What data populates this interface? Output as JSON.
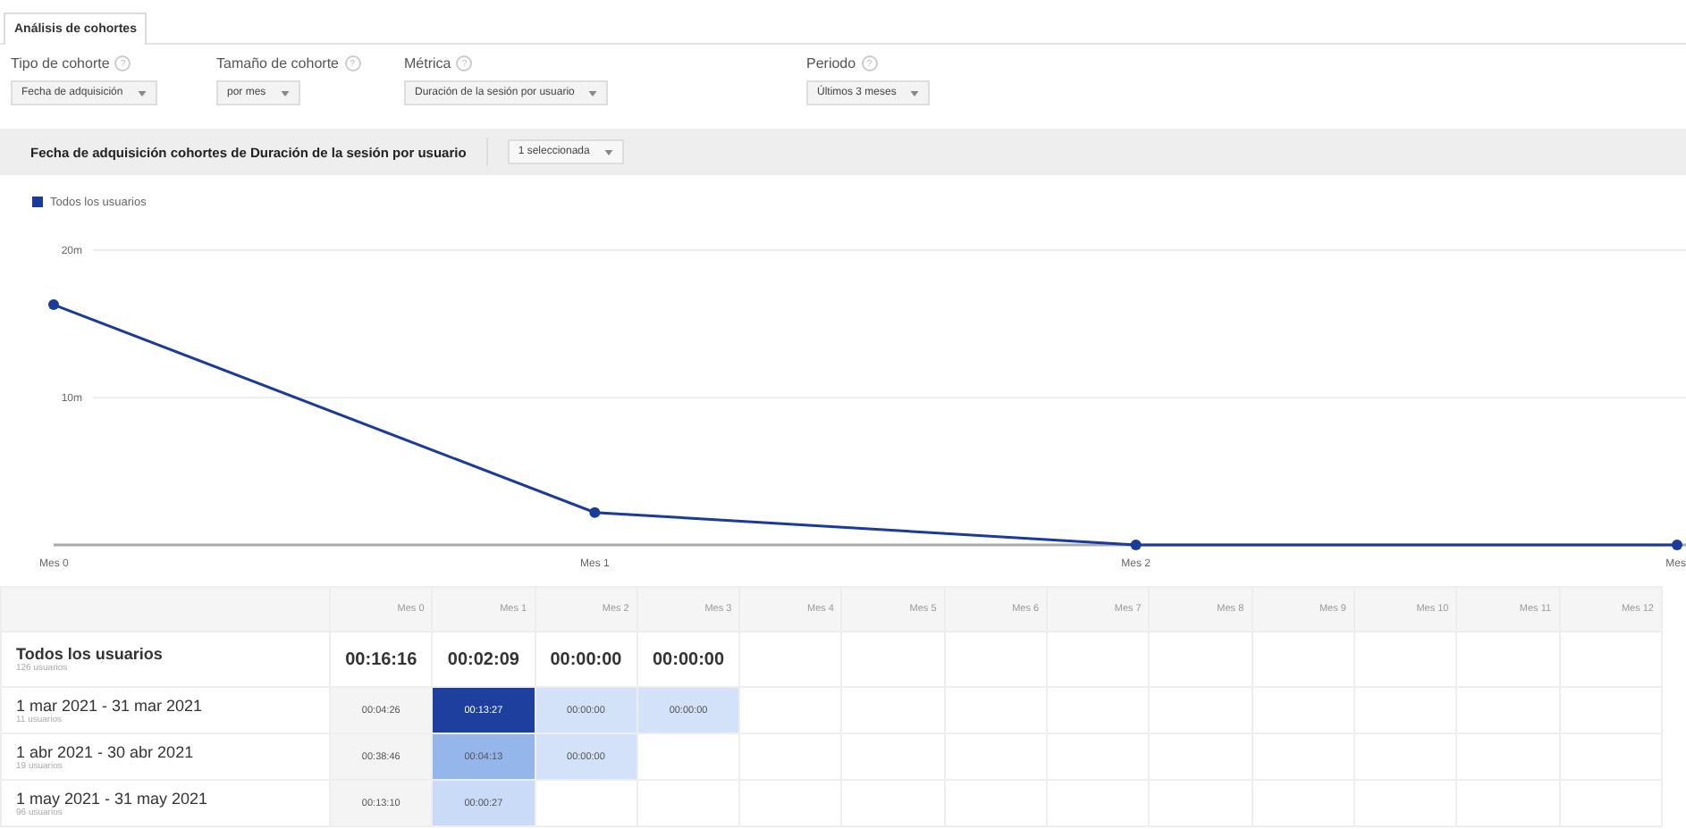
{
  "tabs": [
    {
      "label": "Análisis de cohortes",
      "selected": true
    }
  ],
  "filters": [
    {
      "label": "Tipo de cohorte",
      "help": "?",
      "value": "Fecha de adquisición"
    },
    {
      "label": "Tamaño de cohorte",
      "help": "?",
      "value": "por mes"
    },
    {
      "label": "Métrica",
      "help": "?",
      "value": "Duración de la sesión por usuario"
    },
    {
      "label": "Periodo",
      "help": "?",
      "value": "Últimos 3 meses"
    }
  ],
  "chart_header": {
    "title": "Fecha de adquisición cohortes de Duración de la sesión por usuario",
    "selector": "1 seleccionada"
  },
  "chart_data": {
    "type": "line",
    "categories": [
      "Mes 0",
      "Mes 1",
      "Mes 2",
      "Mes"
    ],
    "ylim": [
      0,
      20
    ],
    "yticks": [
      {
        "value": 10,
        "label": "10m"
      },
      {
        "value": 20,
        "label": "20m"
      }
    ],
    "series": [
      {
        "name": "Todos los usuarios",
        "color": "#1a3a9c",
        "values": [
          16.3,
          2.2,
          0,
          0
        ]
      }
    ]
  },
  "table": {
    "columns": [
      "Mes 0",
      "Mes 1",
      "Mes 2",
      "Mes 3",
      "Mes 4",
      "Mes 5",
      "Mes 6",
      "Mes 7",
      "Mes 8",
      "Mes 9",
      "Mes 10",
      "Mes 11",
      "Mes 12"
    ],
    "total": {
      "label": "Todos los usuarios",
      "users": "126 usuarios",
      "cells": [
        "00:16:16",
        "00:02:09",
        "00:00:00",
        "00:00:00"
      ]
    },
    "rows": [
      {
        "label": "1 mar 2021 - 31 mar 2021",
        "users": "11 usuarios",
        "cells": [
          {
            "value": "00:04:26",
            "color": "#f4f4f4"
          },
          {
            "value": "00:13:27",
            "color": "#1f3f9e"
          },
          {
            "value": "00:00:00",
            "color": "#d3e2f8"
          },
          {
            "value": "00:00:00",
            "color": "#d3e2f8"
          }
        ]
      },
      {
        "label": "1 abr 2021 - 30 abr 2021",
        "users": "19 usuarios",
        "cells": [
          {
            "value": "00:38:46",
            "color": "#f4f4f4"
          },
          {
            "value": "00:04:13",
            "color": "#94b6ea"
          },
          {
            "value": "00:00:00",
            "color": "#d3e2f8"
          }
        ]
      },
      {
        "label": "1 may 2021 - 31 may 2021",
        "users": "96 usuarios",
        "cells": [
          {
            "value": "00:13:10",
            "color": "#f4f4f4"
          },
          {
            "value": "00:00:27",
            "color": "#c9dbf6"
          }
        ]
      }
    ]
  }
}
